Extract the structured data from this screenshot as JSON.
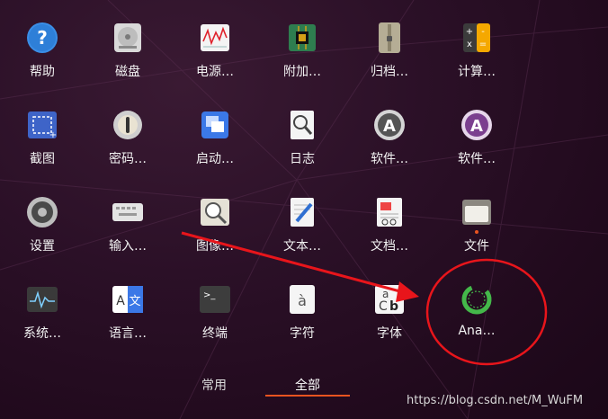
{
  "apps": [
    {
      "label": "帮助",
      "icon": "help-icon"
    },
    {
      "label": "磁盘",
      "icon": "disks-icon"
    },
    {
      "label": "电源…",
      "icon": "power-statistics-icon"
    },
    {
      "label": "附加…",
      "icon": "additional-drivers-icon"
    },
    {
      "label": "归档…",
      "icon": "archive-manager-icon"
    },
    {
      "label": "计算…",
      "icon": "calculator-icon"
    },
    {
      "label": "截图",
      "icon": "screenshot-icon"
    },
    {
      "label": "密码…",
      "icon": "passwords-keys-icon"
    },
    {
      "label": "启动…",
      "icon": "startup-applications-icon"
    },
    {
      "label": "日志",
      "icon": "logs-icon"
    },
    {
      "label": "软件…",
      "icon": "software-updater-icon"
    },
    {
      "label": "软件…",
      "icon": "software-center-icon"
    },
    {
      "label": "设置",
      "icon": "settings-icon"
    },
    {
      "label": "输入…",
      "icon": "input-method-icon"
    },
    {
      "label": "图像…",
      "icon": "image-viewer-icon"
    },
    {
      "label": "文本…",
      "icon": "text-editor-icon"
    },
    {
      "label": "文档…",
      "icon": "document-viewer-icon"
    },
    {
      "label": "文件",
      "icon": "files-icon"
    },
    {
      "label": "系统…",
      "icon": "system-monitor-icon"
    },
    {
      "label": "语言…",
      "icon": "language-support-icon"
    },
    {
      "label": "终端",
      "icon": "terminal-icon"
    },
    {
      "label": "字符",
      "icon": "characters-icon"
    },
    {
      "label": "字体",
      "icon": "fonts-icon"
    },
    {
      "label": "Ana…",
      "icon": "anaconda-icon"
    }
  ],
  "tabs": {
    "frequent": "常用",
    "all": "全部"
  },
  "watermark": "https://blog.csdn.net/M_WuFM",
  "colors": {
    "accent": "#e95420",
    "annotation": "#e8151b",
    "background": "#2b1027"
  }
}
